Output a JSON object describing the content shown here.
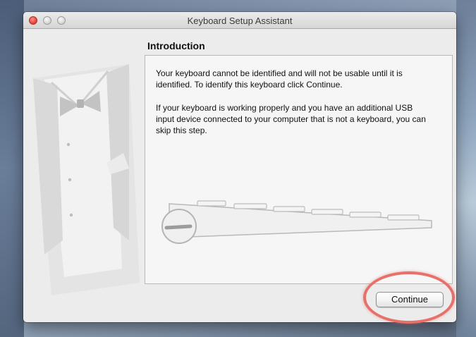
{
  "window": {
    "title": "Keyboard Setup Assistant"
  },
  "content": {
    "section_title": "Introduction",
    "paragraph_1": "Your keyboard cannot be identified and will not be usable until it is identified. To identify this keyboard click Continue.",
    "paragraph_2": "If your keyboard is working properly and you have an additional USB input device connected to your computer that is not a keyboard, you can skip this step."
  },
  "buttons": {
    "continue_label": "Continue"
  },
  "colors": {
    "highlight_ring": "#e8706a",
    "window_background": "#ececec"
  }
}
